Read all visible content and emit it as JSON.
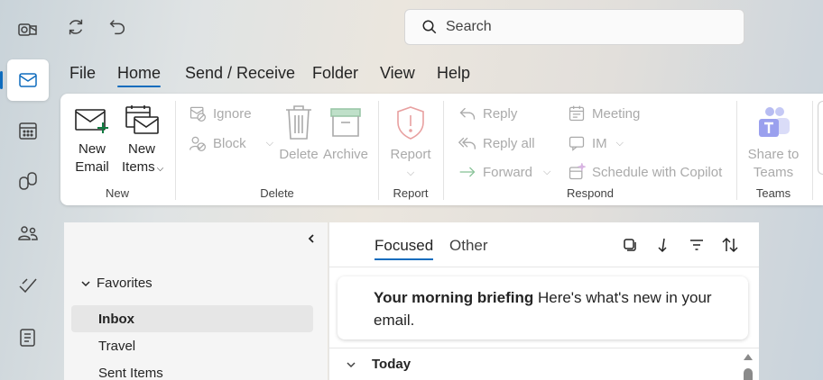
{
  "search": {
    "placeholder": "Search"
  },
  "menu": {
    "tabs": [
      "File",
      "Home",
      "Send / Receive",
      "Folder",
      "View",
      "Help"
    ],
    "active": "Home"
  },
  "ribbon": {
    "new_group": {
      "label": "New",
      "new_email": "New\nEmail",
      "new_items": "New\nItems"
    },
    "delete_group": {
      "label": "Delete",
      "ignore": "Ignore",
      "block": "Block",
      "delete": "Delete",
      "archive": "Archive"
    },
    "report_group": {
      "label": "Report",
      "report": "Report"
    },
    "respond_group": {
      "label": "Respond",
      "reply": "Reply",
      "reply_all": "Reply all",
      "forward": "Forward",
      "meeting": "Meeting",
      "im": "IM",
      "schedule_copilot": "Schedule with Copilot"
    },
    "teams_group": {
      "label": "Teams",
      "share_to_teams": "Share to\nTeams"
    }
  },
  "folders": {
    "favorites_label": "Favorites",
    "items": [
      "Inbox",
      "Travel",
      "Sent Items"
    ],
    "selected": "Inbox"
  },
  "message_list": {
    "tabs": [
      "Focused",
      "Other"
    ],
    "active_tab": "Focused",
    "briefing_title": "Your morning briefing",
    "briefing_text": " Here's what's new in your email.",
    "group_header": "Today"
  },
  "colors": {
    "accent": "#0f6cbd",
    "teams": "#7b83eb",
    "report": "#d13438"
  }
}
